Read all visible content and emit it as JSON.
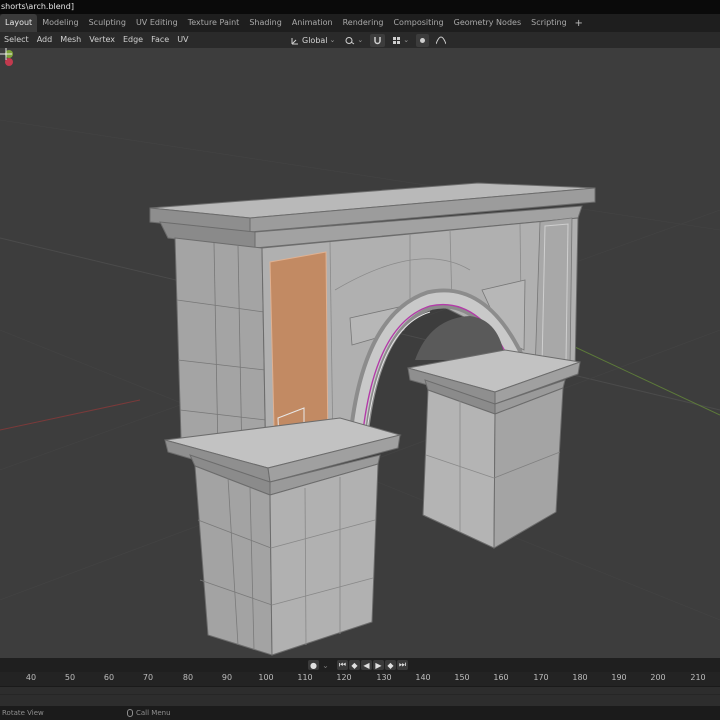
{
  "window": {
    "title": "shorts\\arch.blend]"
  },
  "workspaces": {
    "tabs": [
      "Layout",
      "Modeling",
      "Sculpting",
      "UV Editing",
      "Texture Paint",
      "Shading",
      "Animation",
      "Rendering",
      "Compositing",
      "Geometry Nodes",
      "Scripting"
    ],
    "active": "Layout",
    "add_label": "+"
  },
  "editor_header": {
    "menus": [
      "Select",
      "Add",
      "Mesh",
      "Vertex",
      "Edge",
      "Face",
      "UV"
    ],
    "orientation": "Global"
  },
  "timeline": {
    "frame_ticks": [
      "40",
      "50",
      "60",
      "70",
      "80",
      "90",
      "100",
      "110",
      "120",
      "130",
      "140",
      "150",
      "160",
      "170",
      "180",
      "190",
      "200",
      "210"
    ]
  },
  "status_bar": {
    "left": "Rotate View",
    "middle": "Call Menu"
  },
  "colors": {
    "viewport_bg": "#3d3d3d",
    "mesh_face": "#a9a9a9",
    "selected_face": "#c28a63",
    "accent": "#5680c2"
  },
  "icons": [
    "transform-orientation-icon",
    "snap-icon",
    "magnet-icon",
    "proportional-icon",
    "gizmo-axis-icon",
    "cursor-crosshair-icon",
    "record-icon",
    "jump-start-icon",
    "prev-keyframe-icon",
    "play-reverse-icon",
    "play-icon",
    "next-keyframe-icon",
    "jump-end-icon",
    "mouse-icon"
  ]
}
